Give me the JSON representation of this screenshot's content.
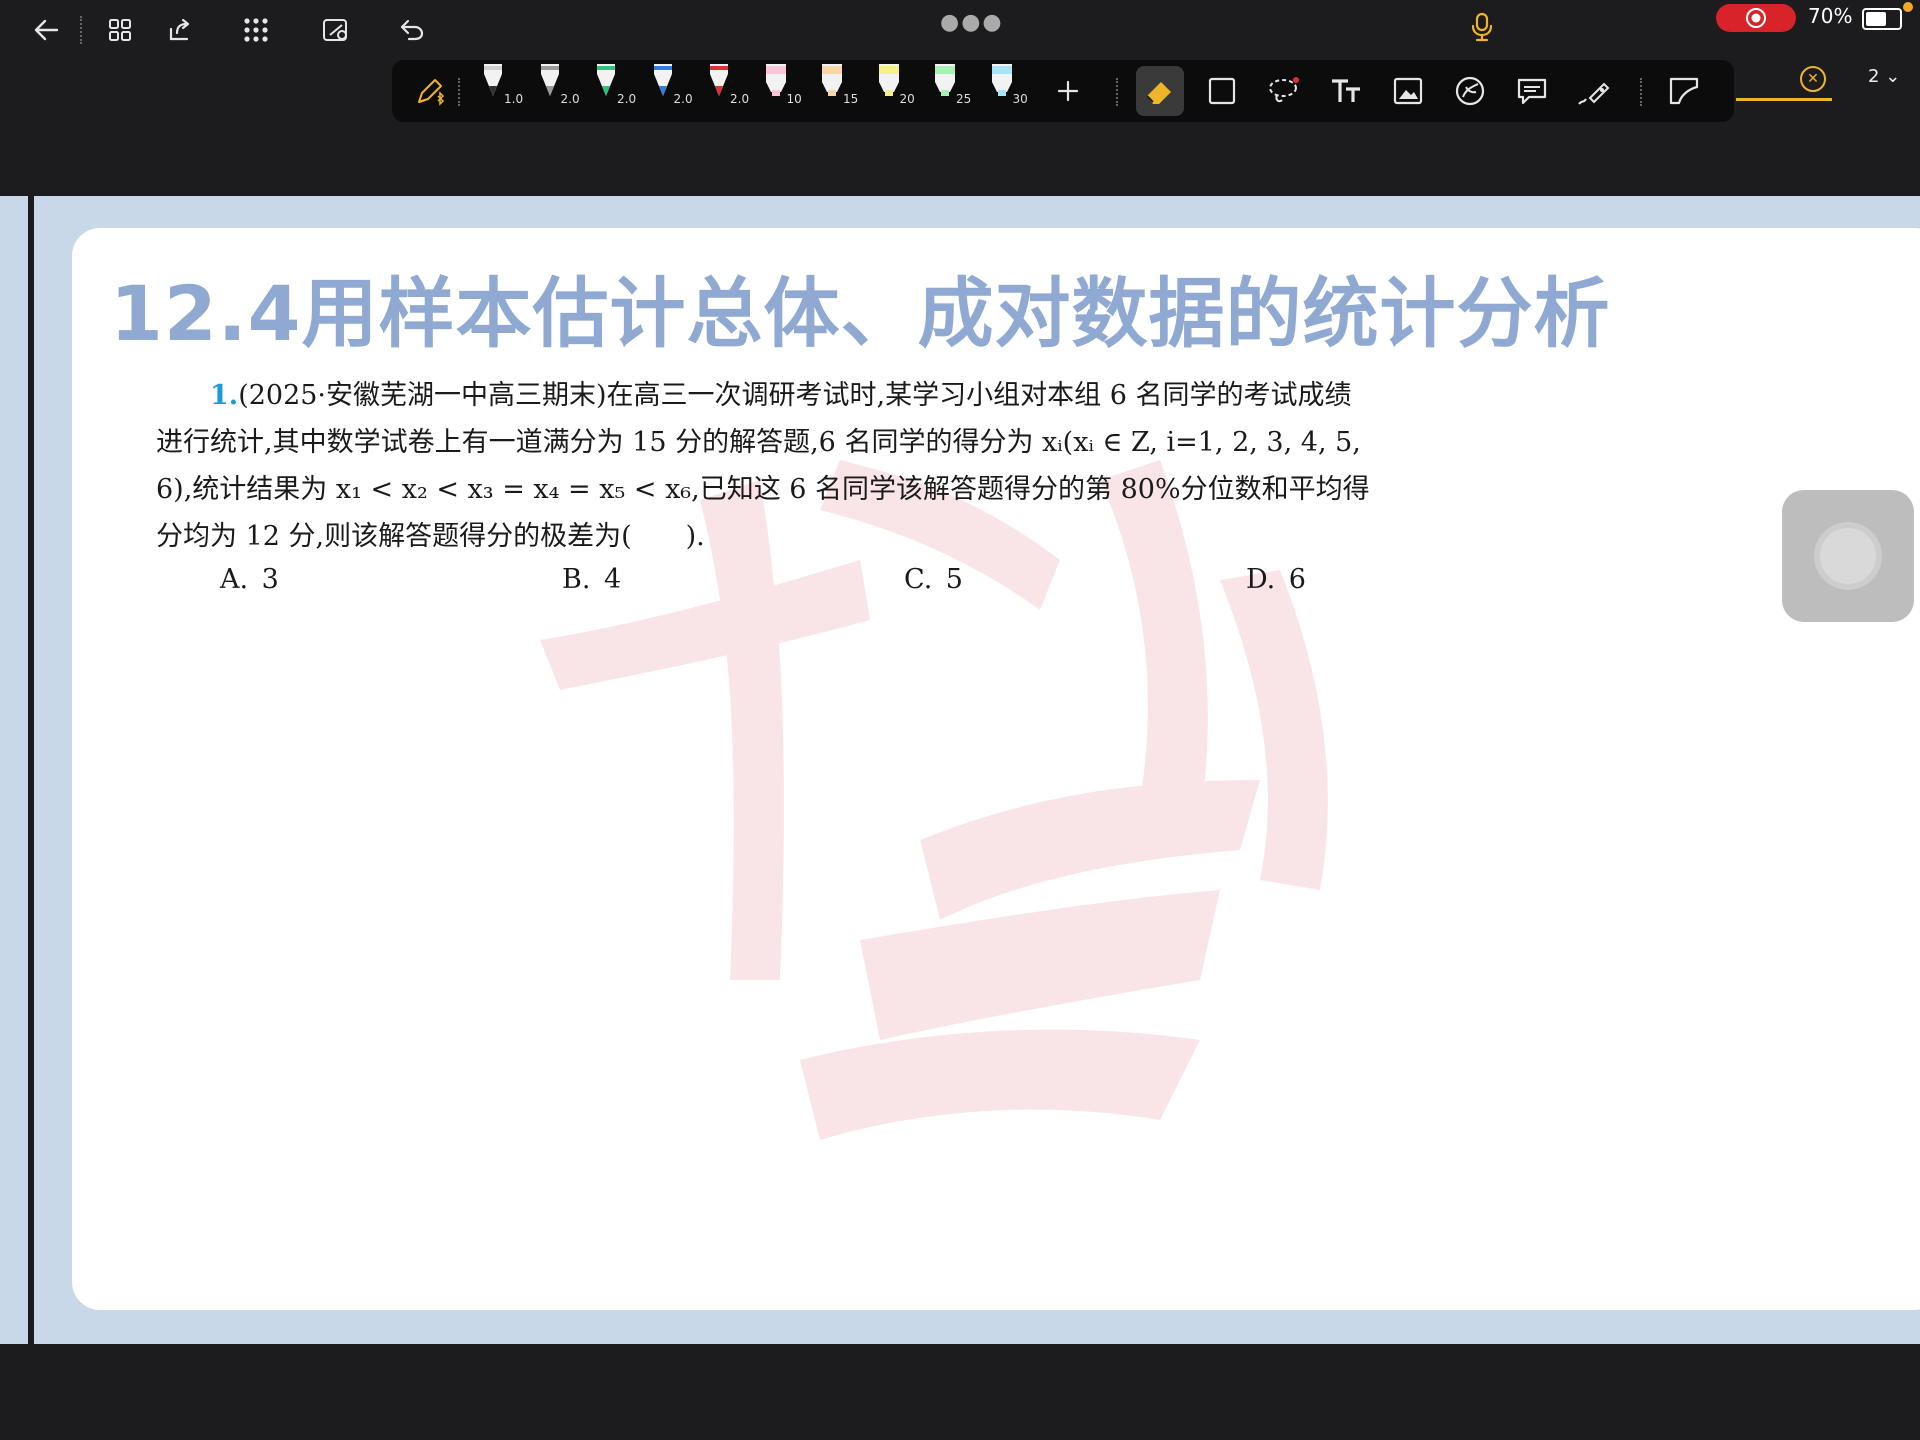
{
  "status_bar": {
    "battery_text": "70%",
    "battery_level": 0.7,
    "page_number": "2"
  },
  "top_icons": [
    "back-arrow-icon",
    "grid-icon",
    "export-icon",
    "apps-icon",
    "sync-icon",
    "undo-icon",
    "more-dots-icon",
    "mic-icon",
    "record-icon"
  ],
  "toolbar": {
    "pens": [
      {
        "size": "1.0",
        "color": "#ffffff"
      },
      {
        "size": "2.0",
        "color": "#9a9a9a"
      },
      {
        "size": "2.0",
        "color": "#2ec27e"
      },
      {
        "size": "2.0",
        "color": "#2f7de1"
      },
      {
        "size": "2.0",
        "color": "#e0303a"
      }
    ],
    "highlighters": [
      {
        "size": "10",
        "color": "#f7c6d9"
      },
      {
        "size": "15",
        "color": "#f9d6a8"
      },
      {
        "size": "20",
        "color": "#f5f08a"
      },
      {
        "size": "25",
        "color": "#a9f0b4"
      },
      {
        "size": "30",
        "color": "#a8e4f5"
      }
    ],
    "accent_color": "#f0b429"
  },
  "document": {
    "heading": "12.4用样本估计总体、成对数据的统计分析",
    "question_number": "1.",
    "question_parts": {
      "line1": "(2025·安徽芜湖一中高三期末)在高三一次调研考试时,某学习小组对本组 6 名同学的考试成绩",
      "line2": "进行统计,其中数学试卷上有一道满分为 15 分的解答题,6 名同学的得分为 xᵢ(xᵢ ∈ Z, i=1, 2, 3, 4, 5,",
      "line3": "6),统计结果为 x₁ < x₂ < x₃ = x₄ = x₅ < x₆,已知这 6 名同学该解答题得分的第 80%分位数和平均得",
      "line4": "分均为 12 分,则该解答题得分的极差为(　　)."
    },
    "options": [
      {
        "letter": "A.",
        "value": "3"
      },
      {
        "letter": "B.",
        "value": "4"
      },
      {
        "letter": "C.",
        "value": "5"
      },
      {
        "letter": "D.",
        "value": "6"
      }
    ]
  }
}
